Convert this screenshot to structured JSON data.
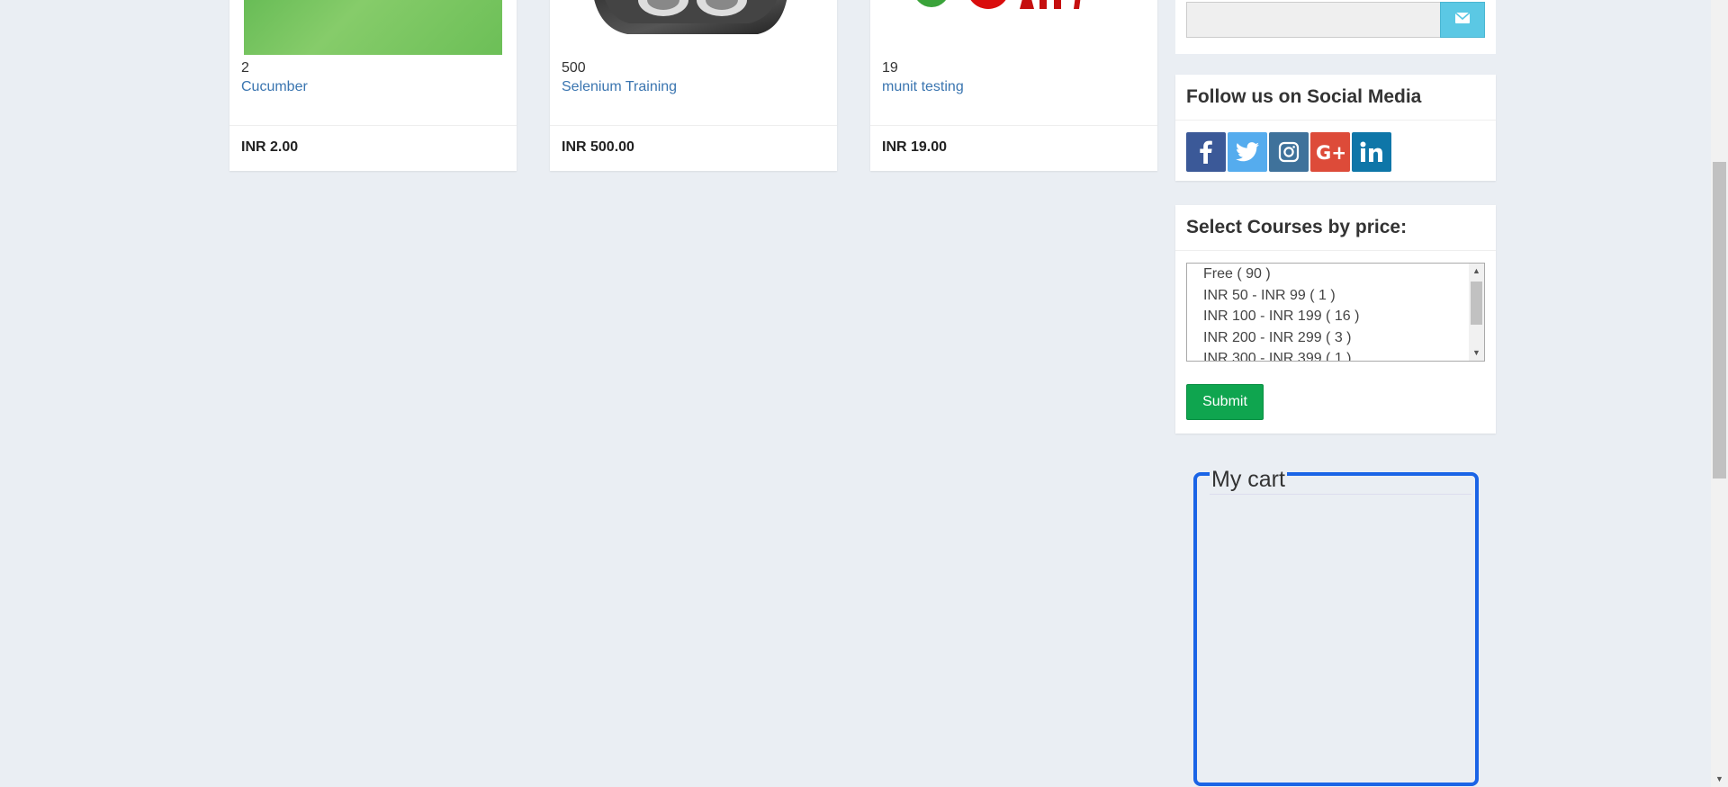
{
  "products": [
    {
      "number": "2",
      "title": "Cucumber",
      "price": "INR 2.00",
      "image": "green-placeholder"
    },
    {
      "number": "500",
      "title": "Selenium Training",
      "price": "INR 500.00",
      "image": "camera-lens"
    },
    {
      "number": "19",
      "title": "munit testing",
      "price": "INR 19.00",
      "image": "red-logo"
    }
  ],
  "search": {
    "value": "",
    "button_icon": "envelope-icon"
  },
  "social": {
    "heading": "Follow us on Social Media",
    "icons": [
      {
        "name": "facebook-icon",
        "glyph": "f",
        "color": "#3b5998"
      },
      {
        "name": "twitter-icon",
        "glyph": "t",
        "color": "#55acee"
      },
      {
        "name": "instagram-icon",
        "glyph": "◎",
        "color": "#3f729b"
      },
      {
        "name": "google-plus-icon",
        "glyph": "G+",
        "color": "#dd4b39"
      },
      {
        "name": "linkedin-icon",
        "glyph": "in",
        "color": "#0e76a8"
      }
    ]
  },
  "price_filter": {
    "heading": "Select Courses by price:",
    "options": [
      "Free ( 90 )",
      "INR 50 - INR 99 ( 1 )",
      "INR 100 - INR 199 ( 16 )",
      "INR 200 - INR 299 ( 3 )",
      "INR 300 - INR 399 ( 1 )"
    ],
    "submit_label": "Submit"
  },
  "cart": {
    "legend": "My cart"
  }
}
